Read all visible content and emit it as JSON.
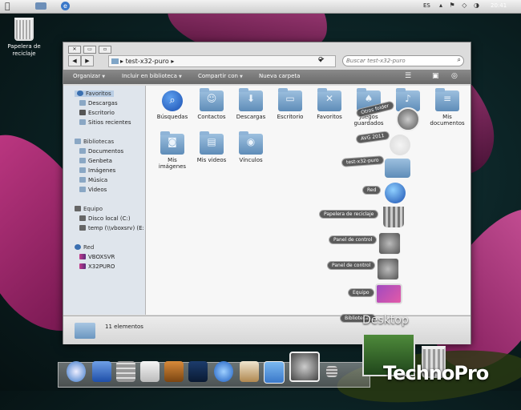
{
  "menubar": {
    "lang": "ES",
    "clock": "20:41"
  },
  "desktop": {
    "recycle_bin_label": "Papelera de reciclaje"
  },
  "window": {
    "breadcrumb": "test-x32-puro",
    "search_placeholder": "Buscar test-x32-puro",
    "toolbar": [
      "Organizar",
      "Incluir en biblioteca",
      "Compartir con",
      "Nueva carpeta"
    ],
    "status": "11 elementos"
  },
  "sidebar": {
    "favorites": {
      "label": "Favoritos",
      "items": [
        "Descargas",
        "Escritorio",
        "Sitios recientes"
      ]
    },
    "libraries": {
      "label": "Bibliotecas",
      "items": [
        "Documentos",
        "Genbeta",
        "Imágenes",
        "Música",
        "Videos"
      ]
    },
    "computer": {
      "label": "Equipo",
      "items": [
        "Disco local (C:)",
        "temp (\\\\vboxsrv) (E:)"
      ]
    },
    "network": {
      "label": "Red",
      "items": [
        "VBOXSVR",
        "X32PURO"
      ]
    }
  },
  "files": [
    {
      "name": "Búsquedas",
      "icon": "magnifier-icon"
    },
    {
      "name": "Contactos",
      "icon": "contacts-folder-icon"
    },
    {
      "name": "Descargas",
      "icon": "downloads-folder-icon"
    },
    {
      "name": "Escritorio",
      "icon": "desktop-folder-icon"
    },
    {
      "name": "Favoritos",
      "icon": "favorites-folder-icon"
    },
    {
      "name": "Juegos guardados",
      "icon": "games-folder-icon"
    },
    {
      "name": "Música",
      "icon": "music-folder-icon"
    },
    {
      "name": "Mis documentos",
      "icon": "documents-folder-icon"
    },
    {
      "name": "Mis imágenes",
      "icon": "pictures-folder-icon"
    },
    {
      "name": "Mis videos",
      "icon": "videos-folder-icon"
    },
    {
      "name": "Vínculos",
      "icon": "links-folder-icon"
    }
  ],
  "stack": {
    "items": [
      "Otros folder",
      "AVG 2011",
      "test-x32-puro",
      "Red",
      "Papelera de reciclaje",
      "Panel de control",
      "Panel de control",
      "Equipo",
      "Bibliotecas"
    ],
    "title": "Desktop"
  },
  "watermark": "TechnoPro"
}
